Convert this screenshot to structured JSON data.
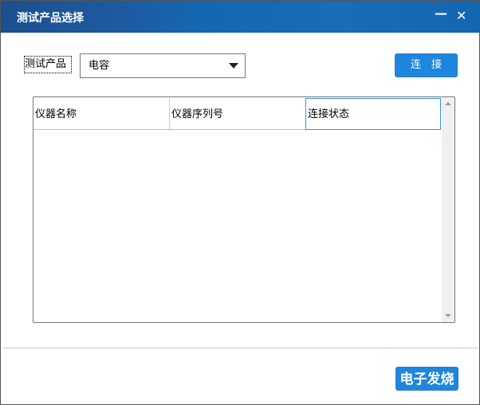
{
  "window": {
    "title": "测试产品选择",
    "minimize": "—",
    "close": "✕"
  },
  "form": {
    "product_label": "测试产品",
    "product_value": "电容",
    "connect_label": "连　接"
  },
  "table": {
    "columns": [
      "仪器名称",
      "仪器序列号",
      "连接状态"
    ],
    "rows": []
  },
  "footer": {
    "next_label": "电子发烧"
  }
}
